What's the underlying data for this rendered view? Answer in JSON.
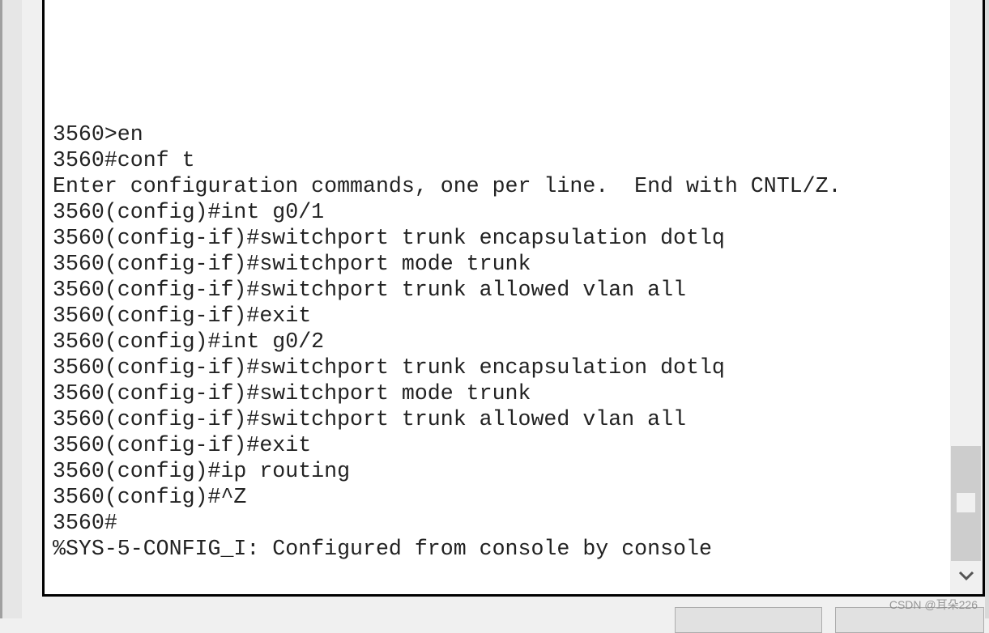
{
  "terminal": {
    "lines": [
      "3560>en",
      "3560#conf t",
      "Enter configuration commands, one per line.  End with CNTL/Z.",
      "3560(config)#int g0/1",
      "3560(config-if)#switchport trunk encapsulation dotlq",
      "3560(config-if)#switchport mode trunk",
      "3560(config-if)#switchport trunk allowed vlan all",
      "3560(config-if)#exit",
      "3560(config)#int g0/2",
      "3560(config-if)#switchport trunk encapsulation dotlq",
      "3560(config-if)#switchport mode trunk",
      "3560(config-if)#switchport trunk allowed vlan all",
      "3560(config-if)#exit",
      "3560(config)#ip routing",
      "3560(config)#^Z",
      "3560#",
      "%SYS-5-CONFIG_I: Configured from console by console"
    ]
  },
  "scrollbar": {
    "position": "bottom",
    "down_icon": "chevron-down-icon"
  },
  "watermark": "CSDN @耳朵226"
}
